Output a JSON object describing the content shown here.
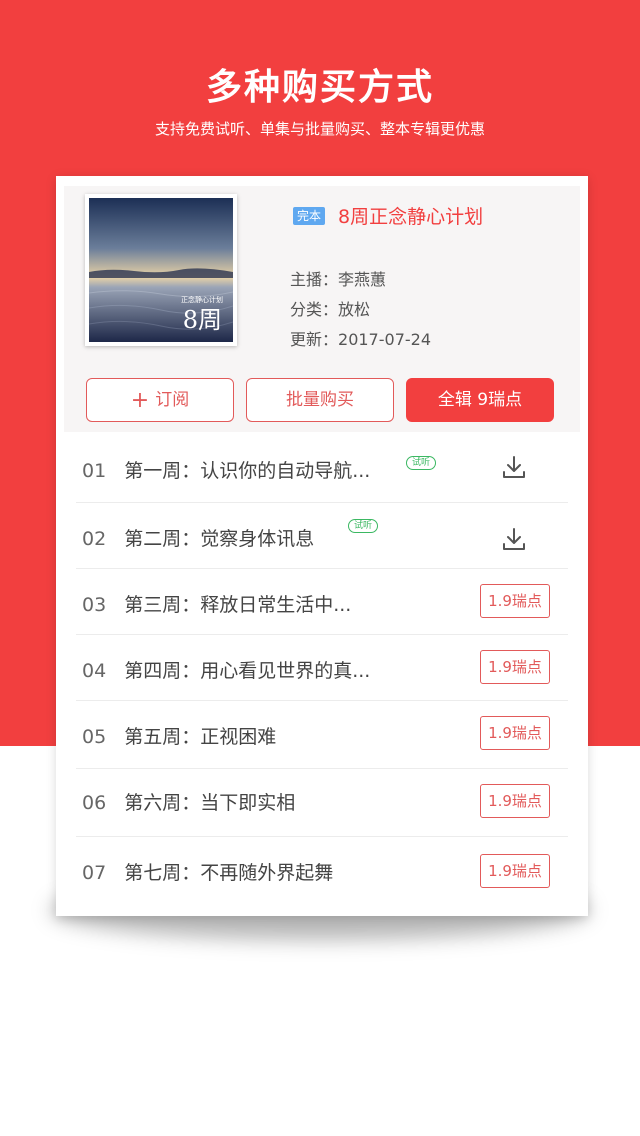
{
  "hero": {
    "title": "多种购买方式",
    "subtitle": "支持免费试听、单集与批量购买、整本专辑更优惠"
  },
  "album": {
    "cover_small_text": "正念静心计划",
    "cover_big_text": "8周",
    "badge": "完本",
    "title": "8周正念静心计划",
    "host_label": "主播：",
    "host": "李燕蕙",
    "category_label": "分类：",
    "category": "放松",
    "updated_label": "更新：",
    "updated": "2017-07-24"
  },
  "actions": {
    "subscribe_icon": "plus-icon",
    "subscribe": "订阅",
    "batch_buy": "批量购买",
    "full_album": "全辑 9瑞点"
  },
  "episodes": [
    {
      "num": "01",
      "title": "第一周：认识你的自动导航...",
      "trial": "试听",
      "action": "download-icon"
    },
    {
      "num": "02",
      "title": "第二周：觉察身体讯息",
      "trial": "试听",
      "action": "download-icon"
    },
    {
      "num": "03",
      "title": "第三周：释放日常生活中...",
      "price": "1.9瑞点"
    },
    {
      "num": "04",
      "title": "第四周：用心看见世界的真...",
      "price": "1.9瑞点"
    },
    {
      "num": "05",
      "title": "第五周：正视困难",
      "price": "1.9瑞点"
    },
    {
      "num": "06",
      "title": "第六周：当下即实相",
      "price": "1.9瑞点"
    },
    {
      "num": "07",
      "title": "第七周：不再随外界起舞",
      "price": "1.9瑞点"
    }
  ],
  "colors": {
    "brand_red": "#f23f3f",
    "trial_green": "#3bb862",
    "badge_blue": "#5fa8f0"
  }
}
